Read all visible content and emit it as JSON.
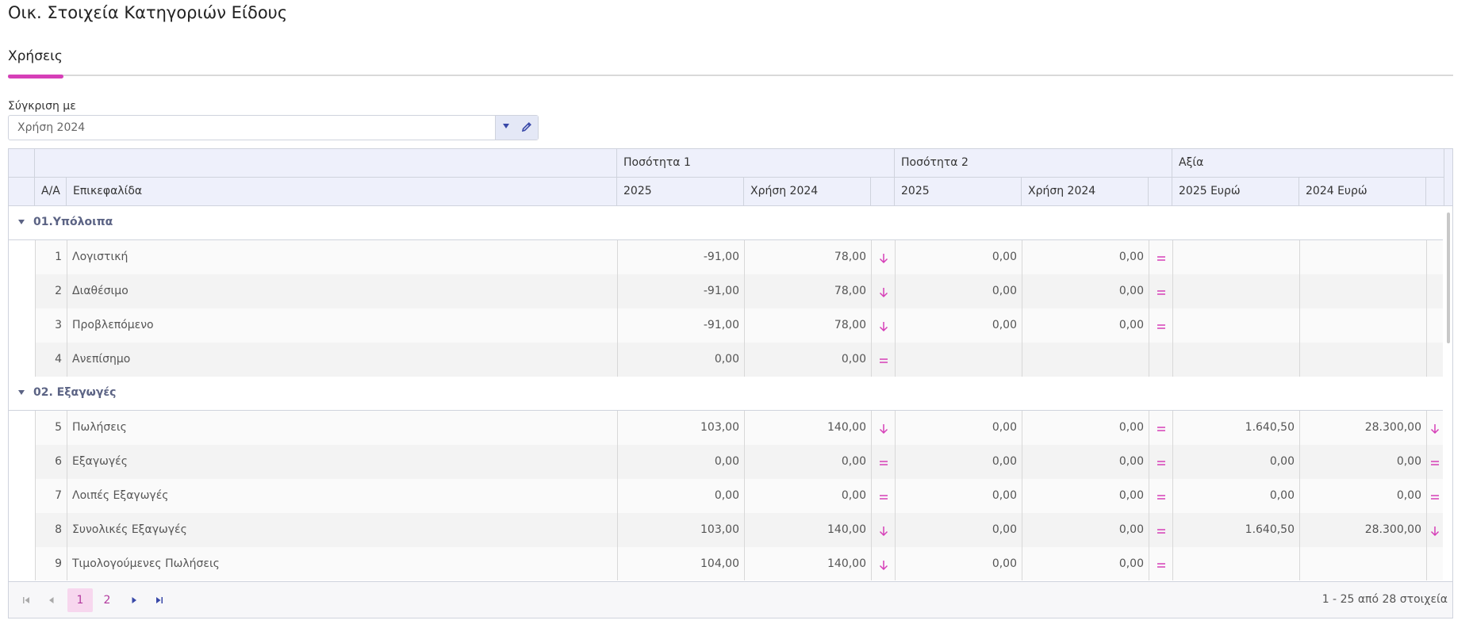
{
  "page": {
    "title": "Οικ. Στοιχεία Κατηγοριών Είδους"
  },
  "tabs": [
    {
      "label": "Χρήσεις",
      "active": true
    }
  ],
  "compare": {
    "label": "Σύγκριση με",
    "value": "Χρήση 2024"
  },
  "grid": {
    "group_headers": {
      "q1": "Ποσότητα 1",
      "q2": "Ποσότητα 2",
      "value": "Αξία"
    },
    "columns": {
      "aa": "Α/Α",
      "heading": "Επικεφαλίδα",
      "q1_cur": "2025",
      "q1_prev": "Χρήση 2024",
      "q2_cur": "2025",
      "q2_prev": "Χρήση 2024",
      "v_cur": "2025 Ευρώ",
      "v_prev": "2024 Ευρώ"
    },
    "groups": [
      {
        "label": "01.Υπόλοιπα",
        "rows": [
          {
            "n": "1",
            "name": "Λογιστική",
            "q1c": "-91,00",
            "q1p": "78,00",
            "q1i": "down",
            "q2c": "0,00",
            "q2p": "0,00",
            "q2i": "eq",
            "vc": "",
            "vp": "",
            "vi": ""
          },
          {
            "n": "2",
            "name": "Διαθέσιμο",
            "q1c": "-91,00",
            "q1p": "78,00",
            "q1i": "down",
            "q2c": "0,00",
            "q2p": "0,00",
            "q2i": "eq",
            "vc": "",
            "vp": "",
            "vi": ""
          },
          {
            "n": "3",
            "name": "Προβλεπόμενο",
            "q1c": "-91,00",
            "q1p": "78,00",
            "q1i": "down",
            "q2c": "0,00",
            "q2p": "0,00",
            "q2i": "eq",
            "vc": "",
            "vp": "",
            "vi": ""
          },
          {
            "n": "4",
            "name": "Ανεπίσημο",
            "q1c": "0,00",
            "q1p": "0,00",
            "q1i": "eq",
            "q2c": "",
            "q2p": "",
            "q2i": "",
            "vc": "",
            "vp": "",
            "vi": ""
          }
        ]
      },
      {
        "label": "02. Εξαγωγές",
        "rows": [
          {
            "n": "5",
            "name": "Πωλήσεις",
            "q1c": "103,00",
            "q1p": "140,00",
            "q1i": "down",
            "q2c": "0,00",
            "q2p": "0,00",
            "q2i": "eq",
            "vc": "1.640,50",
            "vp": "28.300,00",
            "vi": "down"
          },
          {
            "n": "6",
            "name": "Εξαγωγές",
            "q1c": "0,00",
            "q1p": "0,00",
            "q1i": "eq",
            "q2c": "0,00",
            "q2p": "0,00",
            "q2i": "eq",
            "vc": "0,00",
            "vp": "0,00",
            "vi": "eq"
          },
          {
            "n": "7",
            "name": "Λοιπές Εξαγωγές",
            "q1c": "0,00",
            "q1p": "0,00",
            "q1i": "eq",
            "q2c": "0,00",
            "q2p": "0,00",
            "q2i": "eq",
            "vc": "0,00",
            "vp": "0,00",
            "vi": "eq"
          },
          {
            "n": "8",
            "name": "Συνολικές Εξαγωγές",
            "q1c": "103,00",
            "q1p": "140,00",
            "q1i": "down",
            "q2c": "0,00",
            "q2p": "0,00",
            "q2i": "eq",
            "vc": "1.640,50",
            "vp": "28.300,00",
            "vi": "down"
          },
          {
            "n": "9",
            "name": "Τιμολογούμενες Πωλήσεις",
            "q1c": "104,00",
            "q1p": "140,00",
            "q1i": "down",
            "q2c": "0,00",
            "q2p": "0,00",
            "q2i": "eq",
            "vc": "",
            "vp": "",
            "vi": ""
          }
        ]
      }
    ]
  },
  "pager": {
    "pages": [
      "1",
      "2"
    ],
    "current": "1",
    "info": "1 - 25 από 28 στοιχεία"
  },
  "colors": {
    "accent": "#d63fb8",
    "header_bg": "#eef0fb",
    "nav_blue": "#3848a8"
  }
}
